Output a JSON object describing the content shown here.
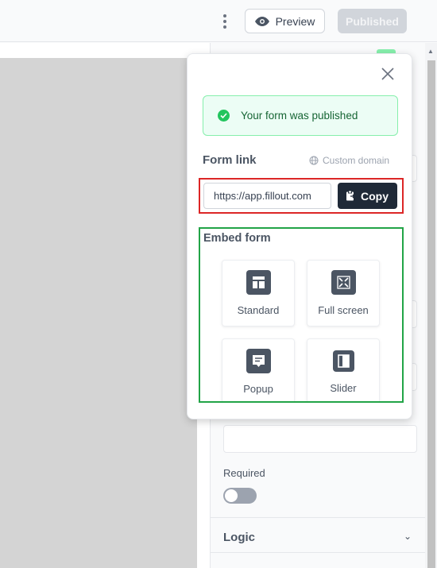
{
  "header": {
    "preview_label": "Preview",
    "published_label": "Published"
  },
  "popup": {
    "success_message": "Your form was published",
    "form_link_title": "Form link",
    "custom_domain_label": "Custom domain",
    "url_value": "https://app.fillout.com",
    "copy_label": "Copy",
    "embed_title": "Embed form",
    "embed_options": [
      {
        "label": "Standard",
        "icon": "layout-icon"
      },
      {
        "label": "Full screen",
        "icon": "expand-icon"
      },
      {
        "label": "Popup",
        "icon": "message-icon"
      },
      {
        "label": "Slider",
        "icon": "sidebar-icon"
      }
    ]
  },
  "panel": {
    "required_label": "Required",
    "required_on": false,
    "logic_label": "Logic"
  },
  "colors": {
    "copy_button": "#1f2937",
    "success_bg": "#ecfdf5",
    "highlight_red": "#dc2626",
    "highlight_green": "#22a447"
  }
}
